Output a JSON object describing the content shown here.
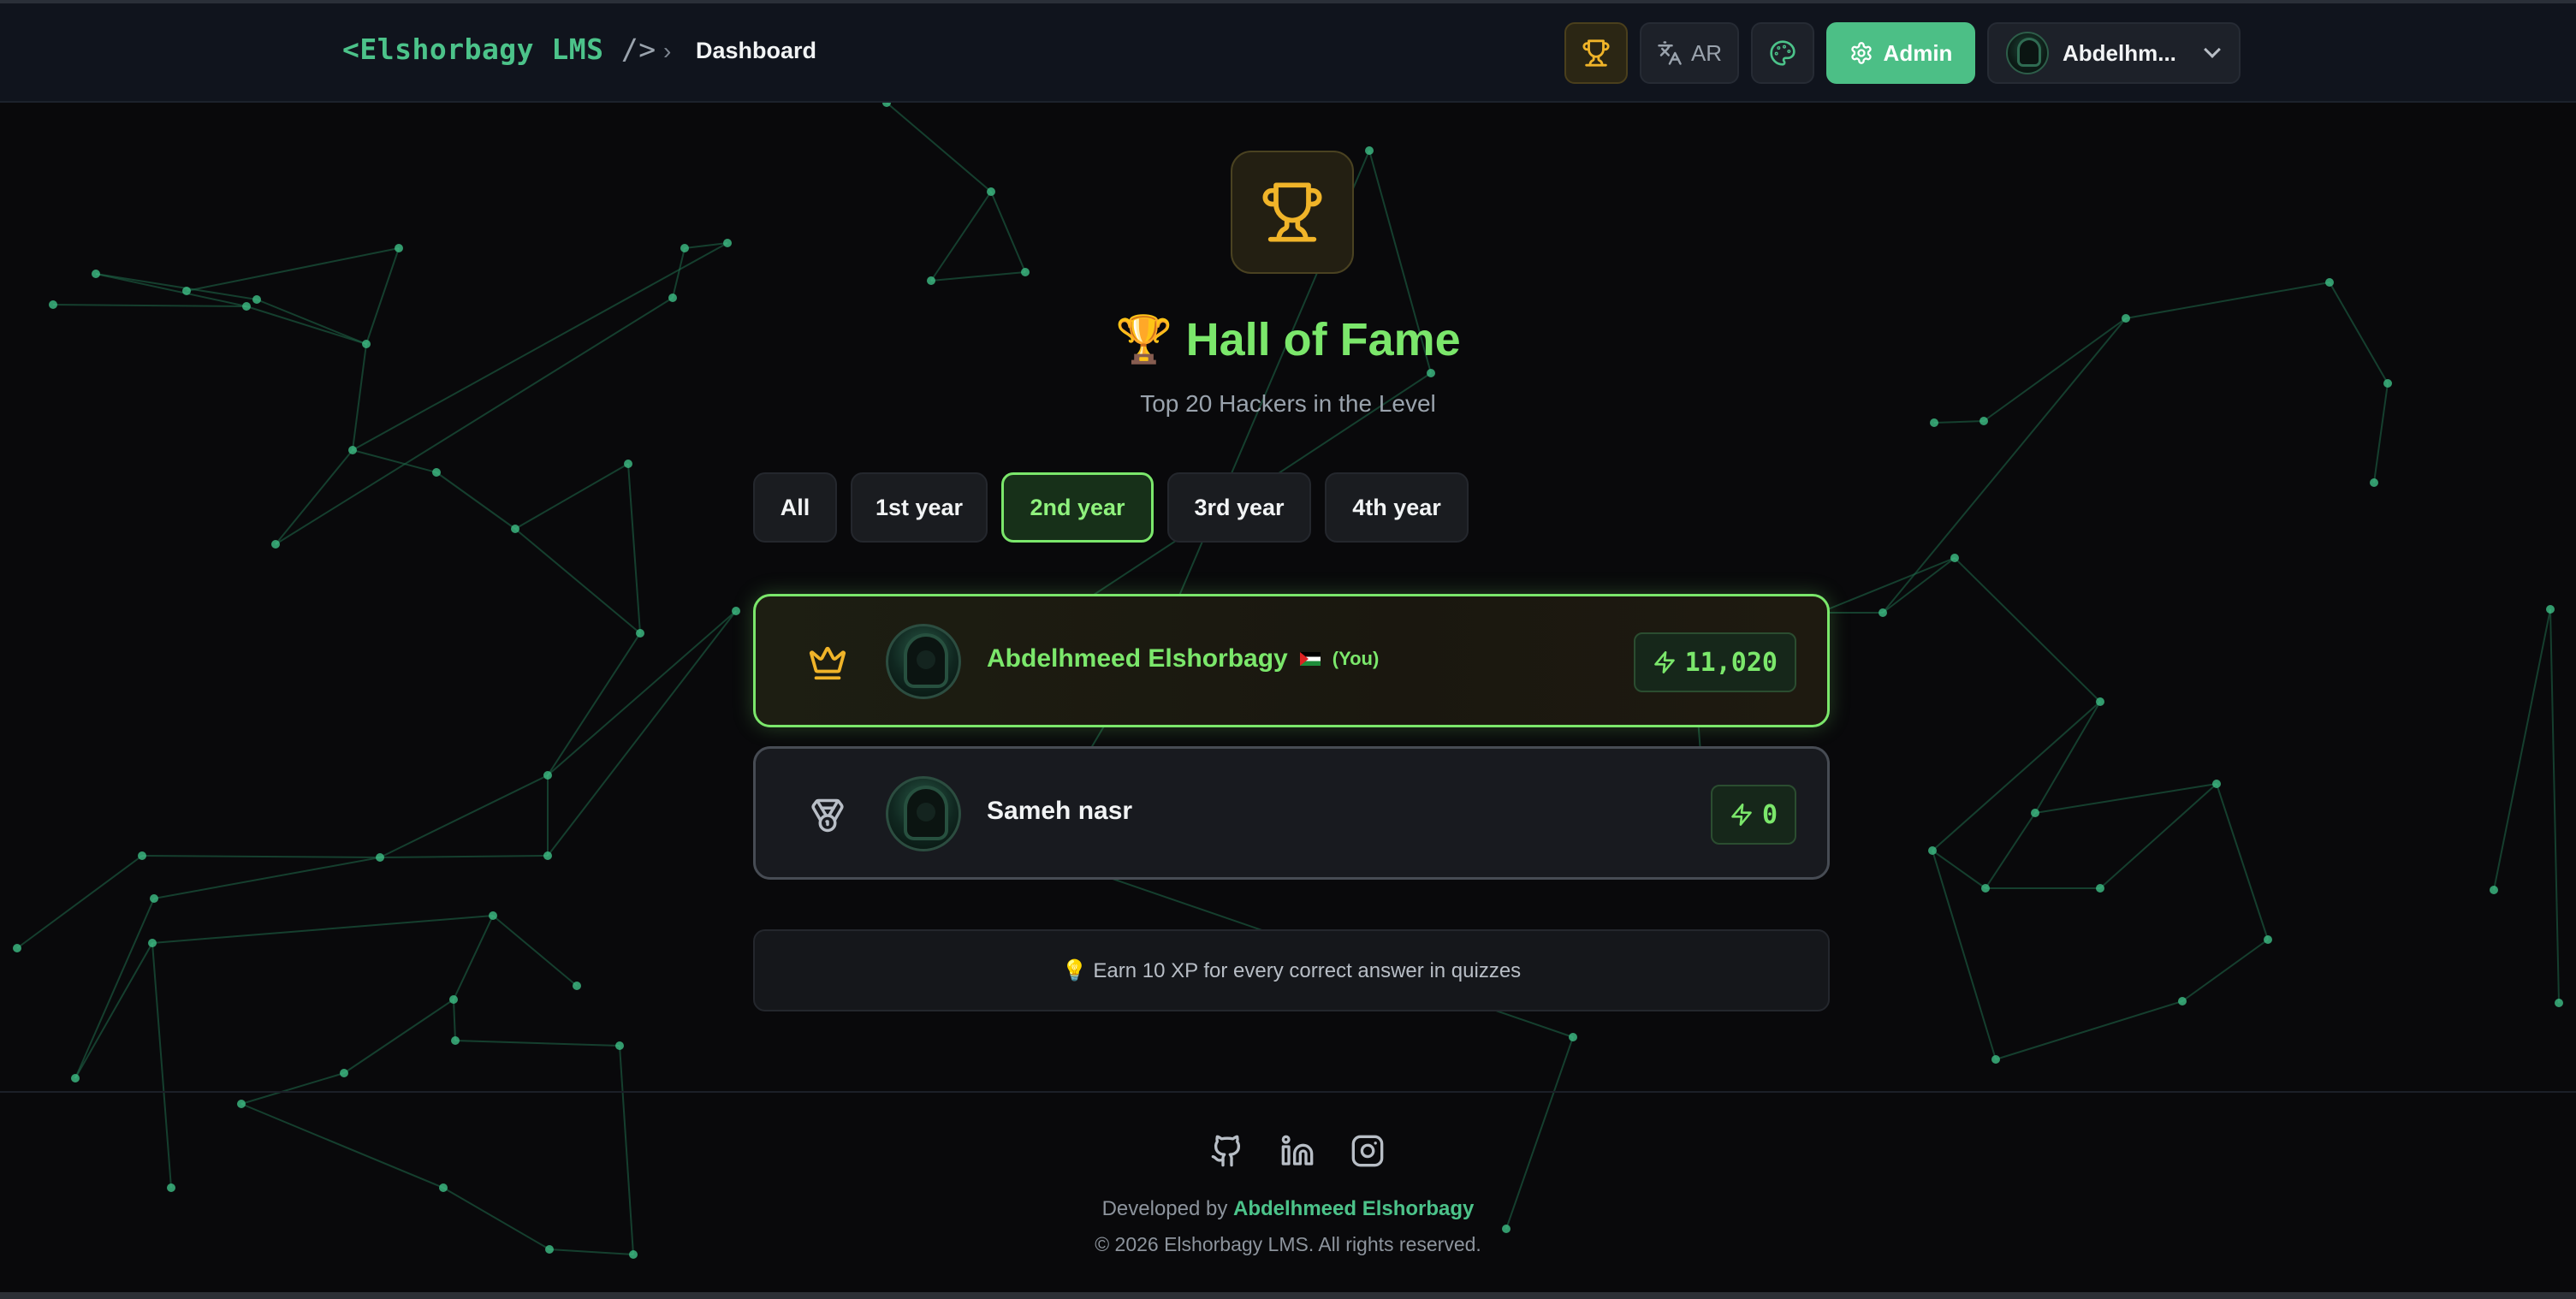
{
  "topbar": {
    "brand": {
      "open": "<Elshorbagy LMS",
      "close": " />"
    },
    "breadcrumb_sep": "›",
    "breadcrumb": "Dashboard",
    "lang_label": "AR",
    "admin_label": "Admin",
    "user_name": "Abdelhm..."
  },
  "hero": {
    "title": "🏆 Hall of Fame",
    "subtitle": "Top 20 Hackers in the Level"
  },
  "tabs": [
    {
      "label": "All",
      "active": false
    },
    {
      "label": "1st year",
      "active": false
    },
    {
      "label": "2nd year",
      "active": true
    },
    {
      "label": "3rd year",
      "active": false
    },
    {
      "label": "4th year",
      "active": false
    }
  ],
  "leaderboard": [
    {
      "rank_icon": "crown-icon",
      "name": "Abdelhmeed Elshorbagy",
      "flag": "palestine-flag",
      "you_label": "(You)",
      "xp": "11,020"
    },
    {
      "rank_icon": "medal-icon",
      "name": "Sameh nasr",
      "xp": "0"
    }
  ],
  "tip": "💡 Earn 10 XP for every correct answer in quizzes",
  "footer": {
    "developed_prefix": "Developed by ",
    "author": "Abdelhmeed Elshorbagy",
    "copyright": "© 2026 Elshorbagy LMS. All rights reserved.",
    "socials": [
      "github-icon",
      "linkedin-icon",
      "instagram-icon"
    ]
  },
  "colors": {
    "accent_green": "#7be76b",
    "brand_green": "#4cc38a",
    "gold": "#f0b429",
    "background": "#09090b"
  }
}
